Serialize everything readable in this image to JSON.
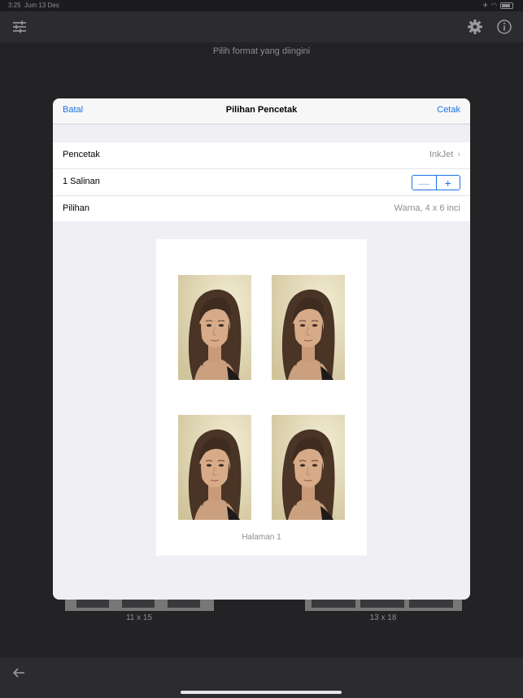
{
  "status_bar": {
    "time": "3:25",
    "date": "Jum 13 Des"
  },
  "toolbar": {
    "left_icon": "sliders-icon",
    "settings_icon": "gear-icon",
    "info_icon": "info-icon"
  },
  "hint": "Pilih format yang diingini",
  "background_formats": [
    {
      "label": "11 x 15"
    },
    {
      "label": "13 x 18"
    }
  ],
  "dialog": {
    "cancel_label": "Batal",
    "title": "Pilihan Pencetak",
    "print_label": "Cetak",
    "rows": {
      "printer": {
        "label": "Pencetak",
        "value": "InkJet"
      },
      "copies": {
        "label": "1 Salinan",
        "minus": "—",
        "plus": "+"
      },
      "options": {
        "label": "Pilihan",
        "value": "Warna, 4 x 6 inci"
      }
    },
    "preview": {
      "page_label": "Halaman 1",
      "photo_count": 4
    }
  },
  "colors": {
    "accent": "#1a73e8",
    "background": "#1c1c1e",
    "toolbar": "#2c2c2e"
  }
}
